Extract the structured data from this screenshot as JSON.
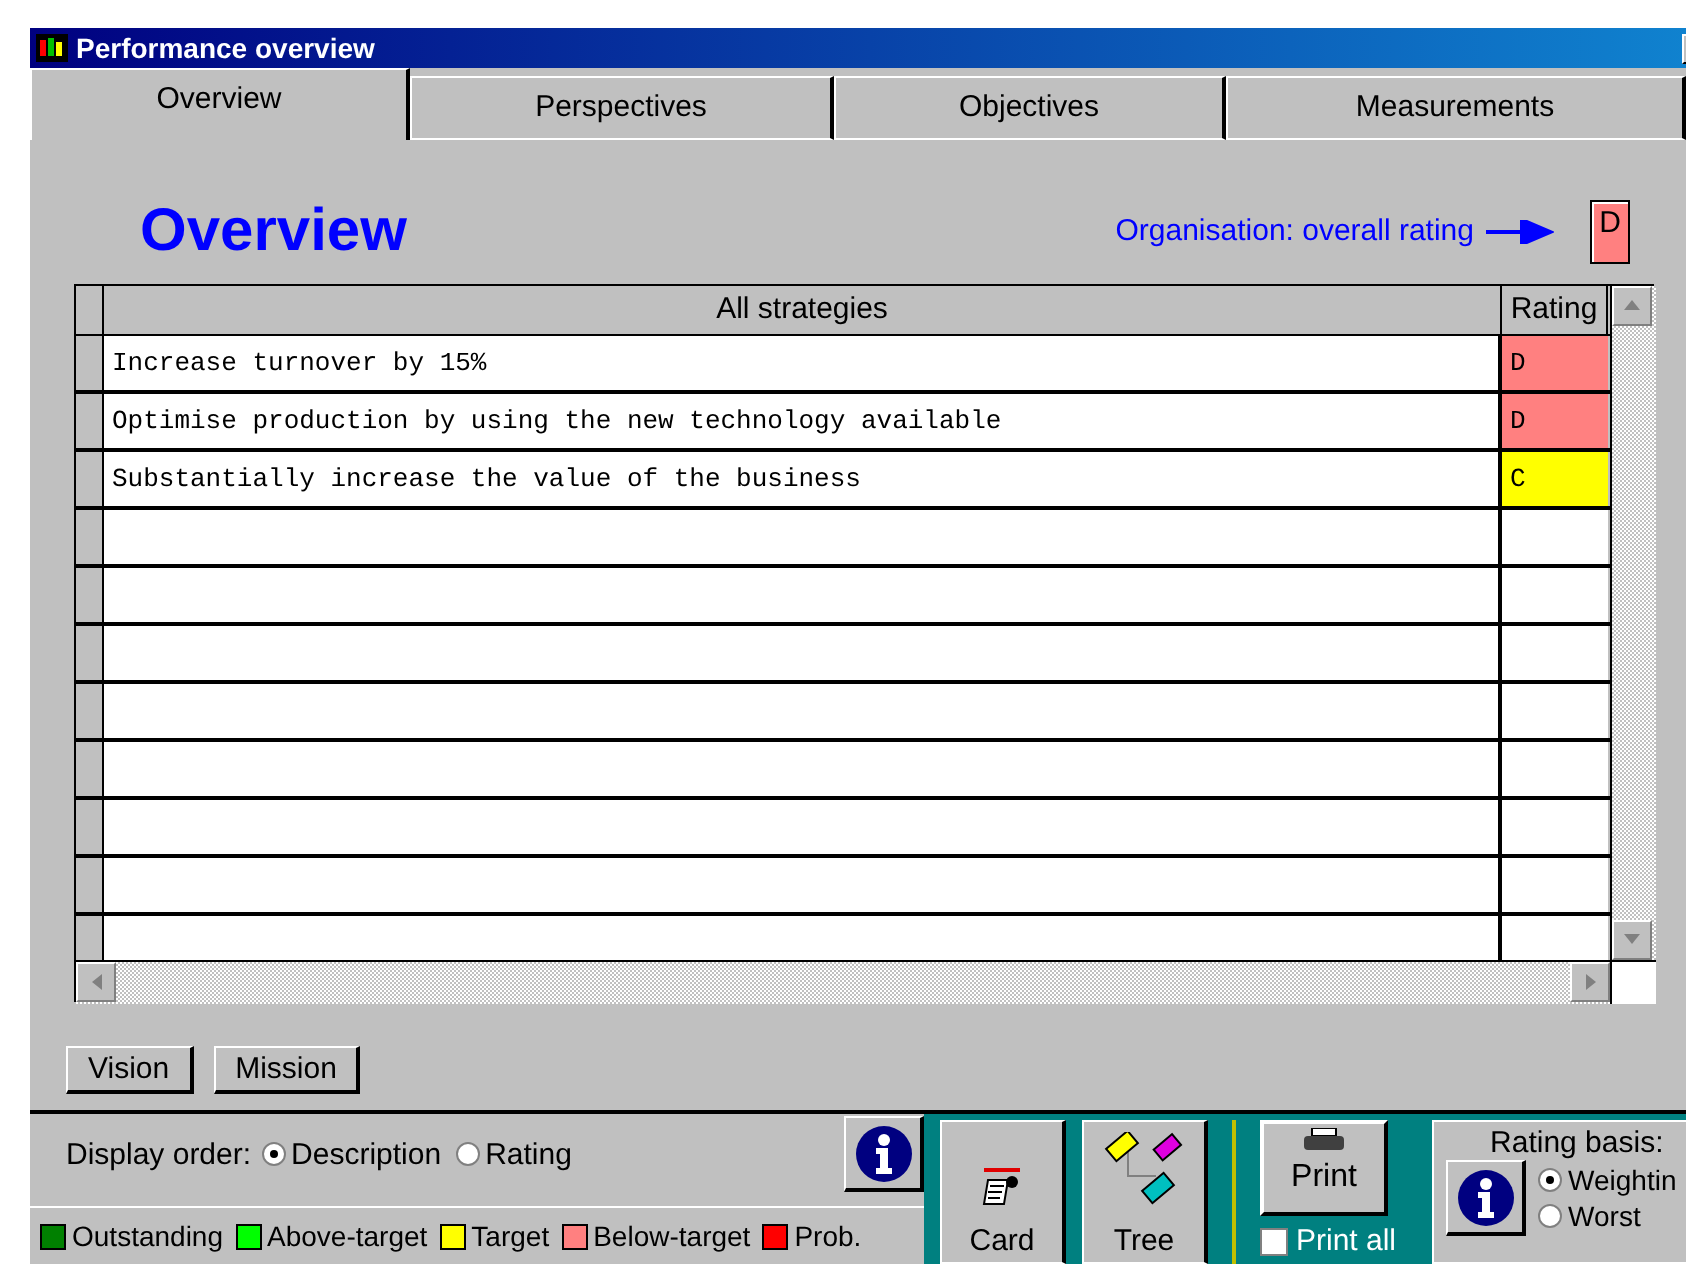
{
  "window": {
    "title": "Performance overview"
  },
  "tabs": [
    {
      "label": "Overview",
      "selected": true
    },
    {
      "label": "Perspectives",
      "selected": false
    },
    {
      "label": "Objectives",
      "selected": false
    },
    {
      "label": "Measurements",
      "selected": false
    }
  ],
  "heading": "Overview",
  "overall_rating": {
    "label": "Organisation: overall rating",
    "value": "D",
    "color": "#ff8080"
  },
  "table": {
    "columns": [
      "All strategies",
      "Rating"
    ],
    "rows": [
      {
        "strategy": "Increase turnover by 15%",
        "rating": "D",
        "color": "#ff8080"
      },
      {
        "strategy": "Optimise production by using the new technology available",
        "rating": "D",
        "color": "#ff8080"
      },
      {
        "strategy": "Substantially increase the value of the business",
        "rating": "C",
        "color": "#ffff00"
      }
    ]
  },
  "buttons": [
    "Vision",
    "Mission"
  ],
  "display_order": {
    "label": "Display order:",
    "options": [
      {
        "label": "Description",
        "selected": true
      },
      {
        "label": "Rating",
        "selected": false
      }
    ]
  },
  "legend": [
    {
      "label": "Outstanding",
      "color": "#008000"
    },
    {
      "label": "Above-target",
      "color": "#00ff00"
    },
    {
      "label": "Target",
      "color": "#ffff00"
    },
    {
      "label": "Below-target",
      "color": "#ff8080"
    },
    {
      "label": "Prob.",
      "color": "#ff0000"
    }
  ],
  "toolbar": {
    "card": "Card",
    "tree": "Tree",
    "print": "Print",
    "print_all": {
      "label": "Print all",
      "checked": false
    }
  },
  "rating_basis": {
    "label": "Rating basis:",
    "options": [
      {
        "label": "Weightin",
        "selected": true
      },
      {
        "label": "Worst",
        "selected": false
      }
    ]
  }
}
